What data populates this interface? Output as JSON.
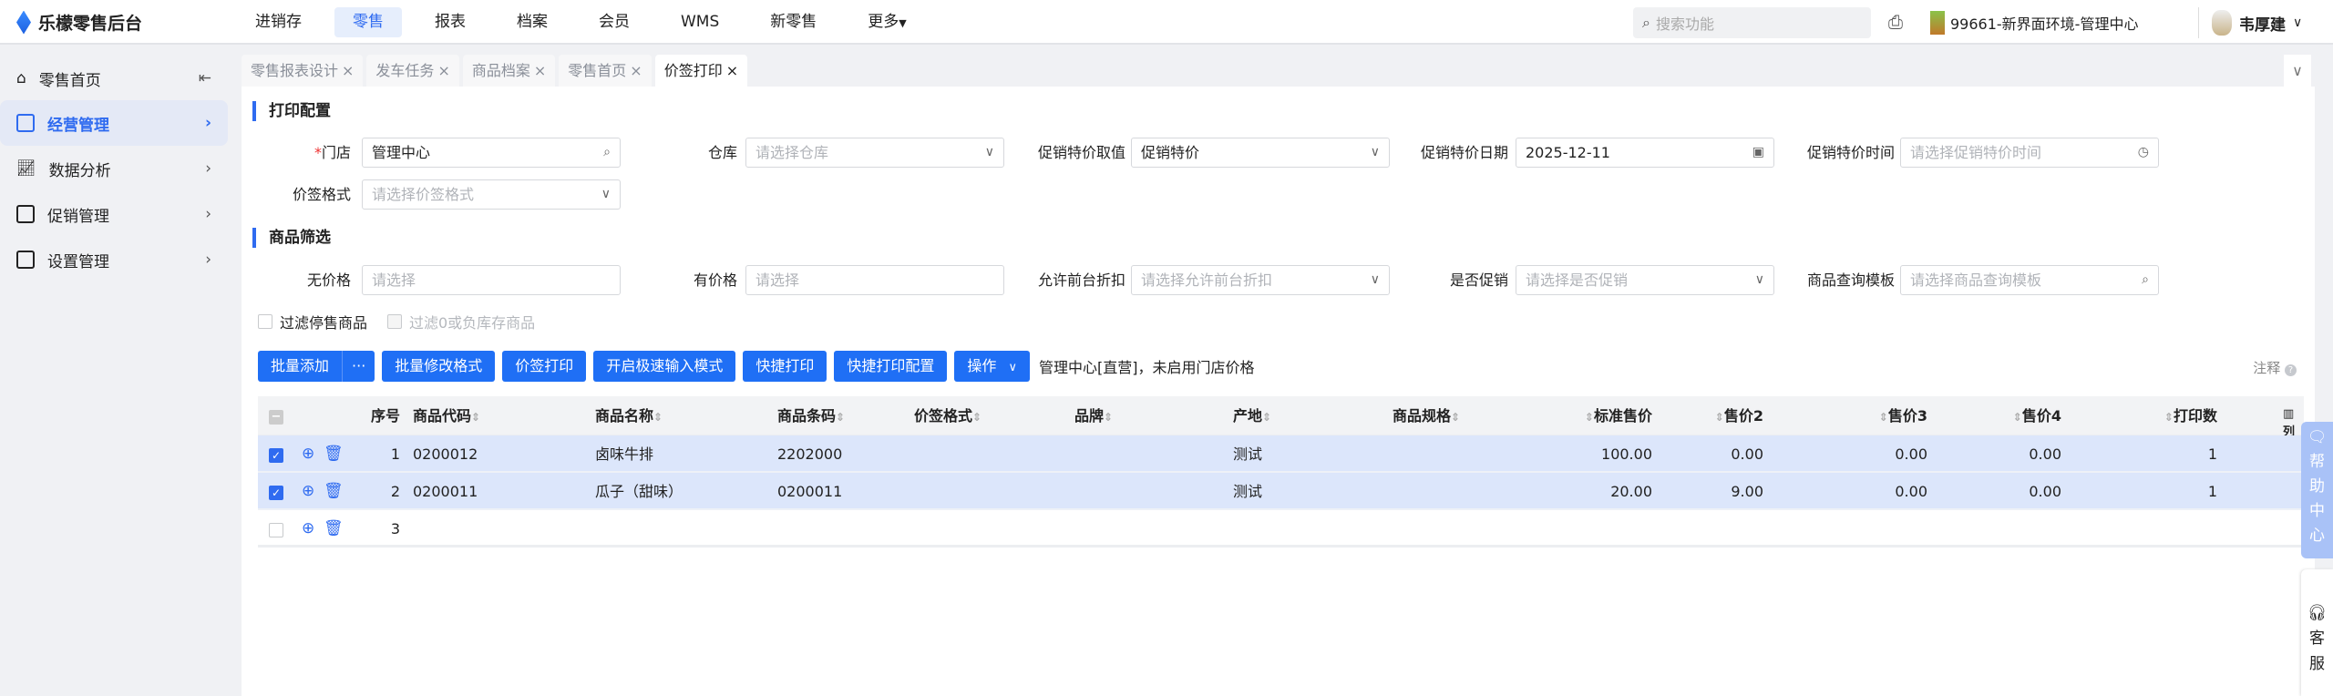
{
  "app": {
    "title": "乐檬零售后台"
  },
  "nav": [
    "进销存",
    "零售",
    "报表",
    "档案",
    "会员",
    "WMS",
    "新零售",
    "更多"
  ],
  "search": {
    "placeholder": "搜索功能"
  },
  "store": "99661-新界面环境-管理中心",
  "user": "韦厚建",
  "sidebar": [
    "零售首页",
    "经营管理",
    "数据分析",
    "促销管理",
    "设置管理"
  ],
  "tabs": [
    "零售报表设计",
    "发车任务",
    "商品档案",
    "零售首页",
    "价签打印"
  ],
  "print_config": {
    "title": "打印配置",
    "store_label": "门店",
    "store_value": "管理中心",
    "warehouse_label": "仓库",
    "warehouse_ph": "请选择仓库",
    "promo_value_label": "促销特价取值",
    "promo_value": "促销特价",
    "promo_date_label": "促销特价日期",
    "promo_date": "2025-12-11",
    "promo_time_label": "促销特价时间",
    "promo_time_ph": "请选择促销特价时间",
    "format_label": "价签格式",
    "format_ph": "请选择价签格式"
  },
  "filter": {
    "title": "商品筛选",
    "no_price_label": "无价格",
    "no_price_ph": "请选择",
    "has_price_label": "有价格",
    "has_price_ph": "请选择",
    "discount_label": "允许前台折扣",
    "discount_ph": "请选择允许前台折扣",
    "promo_label": "是否促销",
    "promo_ph": "请选择是否促销",
    "template_label": "商品查询模板",
    "template_ph": "请选择商品查询模板",
    "chk_stop": "过滤停售商品",
    "chk_stock": "过滤0或负库存商品"
  },
  "toolbar": {
    "batch_add": "批量添加",
    "more": "···",
    "batch_format": "批量修改格式",
    "print": "价签打印",
    "fast_input": "开启极速输入模式",
    "quick_print": "快捷打印",
    "quick_config": "快捷打印配置",
    "ops": "操作",
    "note": "管理中心[直营]，未启用门店价格",
    "annot": "注释"
  },
  "table": {
    "headers": [
      "序号",
      "商品代码",
      "商品名称",
      "商品条码",
      "价签格式",
      "品牌",
      "产地",
      "商品规格",
      "标准售价",
      "售价2",
      "售价3",
      "售价4",
      "打印数"
    ],
    "rows": [
      {
        "no": "1",
        "code": "0200012",
        "name": "卤味牛排",
        "barcode": "2202000",
        "origin": "测试",
        "std": "100.00",
        "p2": "0.00",
        "p3": "0.00",
        "p4": "0.00",
        "qty": "1"
      },
      {
        "no": "2",
        "code": "0200011",
        "name": "瓜子（甜味）",
        "barcode": "0200011",
        "origin": "测试",
        "std": "20.00",
        "p2": "9.00",
        "p3": "0.00",
        "p4": "0.00",
        "qty": "1"
      }
    ],
    "empty_no": "3",
    "col_setting": "列"
  },
  "float": {
    "help": "帮助中心",
    "service": "客服"
  }
}
